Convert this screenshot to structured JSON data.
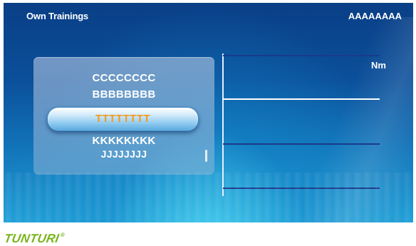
{
  "header": {
    "title": "Own Trainings",
    "user": "AAAAAAAA"
  },
  "selector": {
    "items": [
      {
        "label": "CCCCCCCC",
        "state": "above"
      },
      {
        "label": "BBBBBBBB",
        "state": "above"
      },
      {
        "label": "TTTTTTTT",
        "state": "selected"
      },
      {
        "label": "KKKKKKKK",
        "state": "below"
      },
      {
        "label": "JJJJJJJJ",
        "state": "below"
      }
    ]
  },
  "chart": {
    "unit_label": "Nm",
    "lines": [
      {
        "color": "#1a3a8a"
      },
      {
        "color": "#ffffff"
      },
      {
        "color": "#1a3a8a"
      },
      {
        "color": "#1a3a8a"
      }
    ]
  },
  "footer": {
    "brand": "TUNTURI",
    "brand_mark": "®",
    "brand_color": "#7ab51d"
  },
  "colors": {
    "selected_text": "#f39a1e",
    "background_top": "#0a3f86",
    "background_bottom": "#20a0d7"
  }
}
